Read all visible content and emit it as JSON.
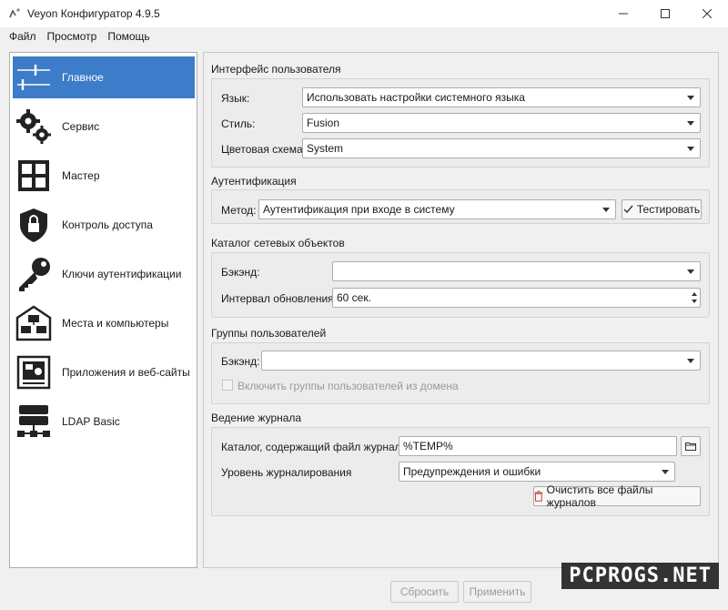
{
  "window": {
    "title": "Veyon Конфигуратор 4.9.5",
    "controls": [
      "minimize-icon",
      "maximize-icon",
      "close-icon"
    ]
  },
  "menu": [
    "Файл",
    "Просмотр",
    "Помощь"
  ],
  "sidebar": {
    "items": [
      {
        "label": "Главное",
        "icon": "sliders-icon",
        "active": true
      },
      {
        "label": "Сервис",
        "icon": "gears-icon"
      },
      {
        "label": "Мастер",
        "icon": "grid-icon"
      },
      {
        "label": "Контроль доступа",
        "icon": "shield-lock-icon"
      },
      {
        "label": "Ключи аутентификации",
        "icon": "key-icon"
      },
      {
        "label": "Места и компьютеры",
        "icon": "computers-icon"
      },
      {
        "label": "Приложения и веб-сайты",
        "icon": "apps-icon"
      },
      {
        "label": "LDAP Basic",
        "icon": "database-icon"
      }
    ],
    "accent": "#3d7cc8"
  },
  "ui_group": {
    "title": "Интерфейс пользователя",
    "language_label": "Язык:",
    "language_value": "Использовать настройки системного языка",
    "style_label": "Стиль:",
    "style_value": "Fusion",
    "scheme_label": "Цветовая схема:",
    "scheme_value": "System"
  },
  "auth_group": {
    "title": "Аутентификация",
    "method_label": "Метод:",
    "method_value": "Аутентификация при входе в систему",
    "test_button": "Тестировать"
  },
  "catalog_group": {
    "title": "Каталог сетевых объектов",
    "backend_label": "Бэкэнд:",
    "backend_value": "",
    "interval_label": "Интервал обновления:",
    "interval_value": "60 сек."
  },
  "usergroups_group": {
    "title": "Группы пользователей",
    "backend_label": "Бэкэнд:",
    "backend_value": "",
    "include_domain_label": "Включить группы пользователей из домена"
  },
  "log_group": {
    "title": "Ведение журнала",
    "dir_label": "Каталог, содержащий файл журнала",
    "dir_value": "%TEMP%",
    "level_label": "Уровень журналирования",
    "level_value": "Предупреждения и ошибки",
    "clear_button": "Очистить все файлы журналов"
  },
  "footer": {
    "reset_button": "Сбросить",
    "apply_button": "Применить"
  },
  "watermark": "PCPROGS.NET"
}
